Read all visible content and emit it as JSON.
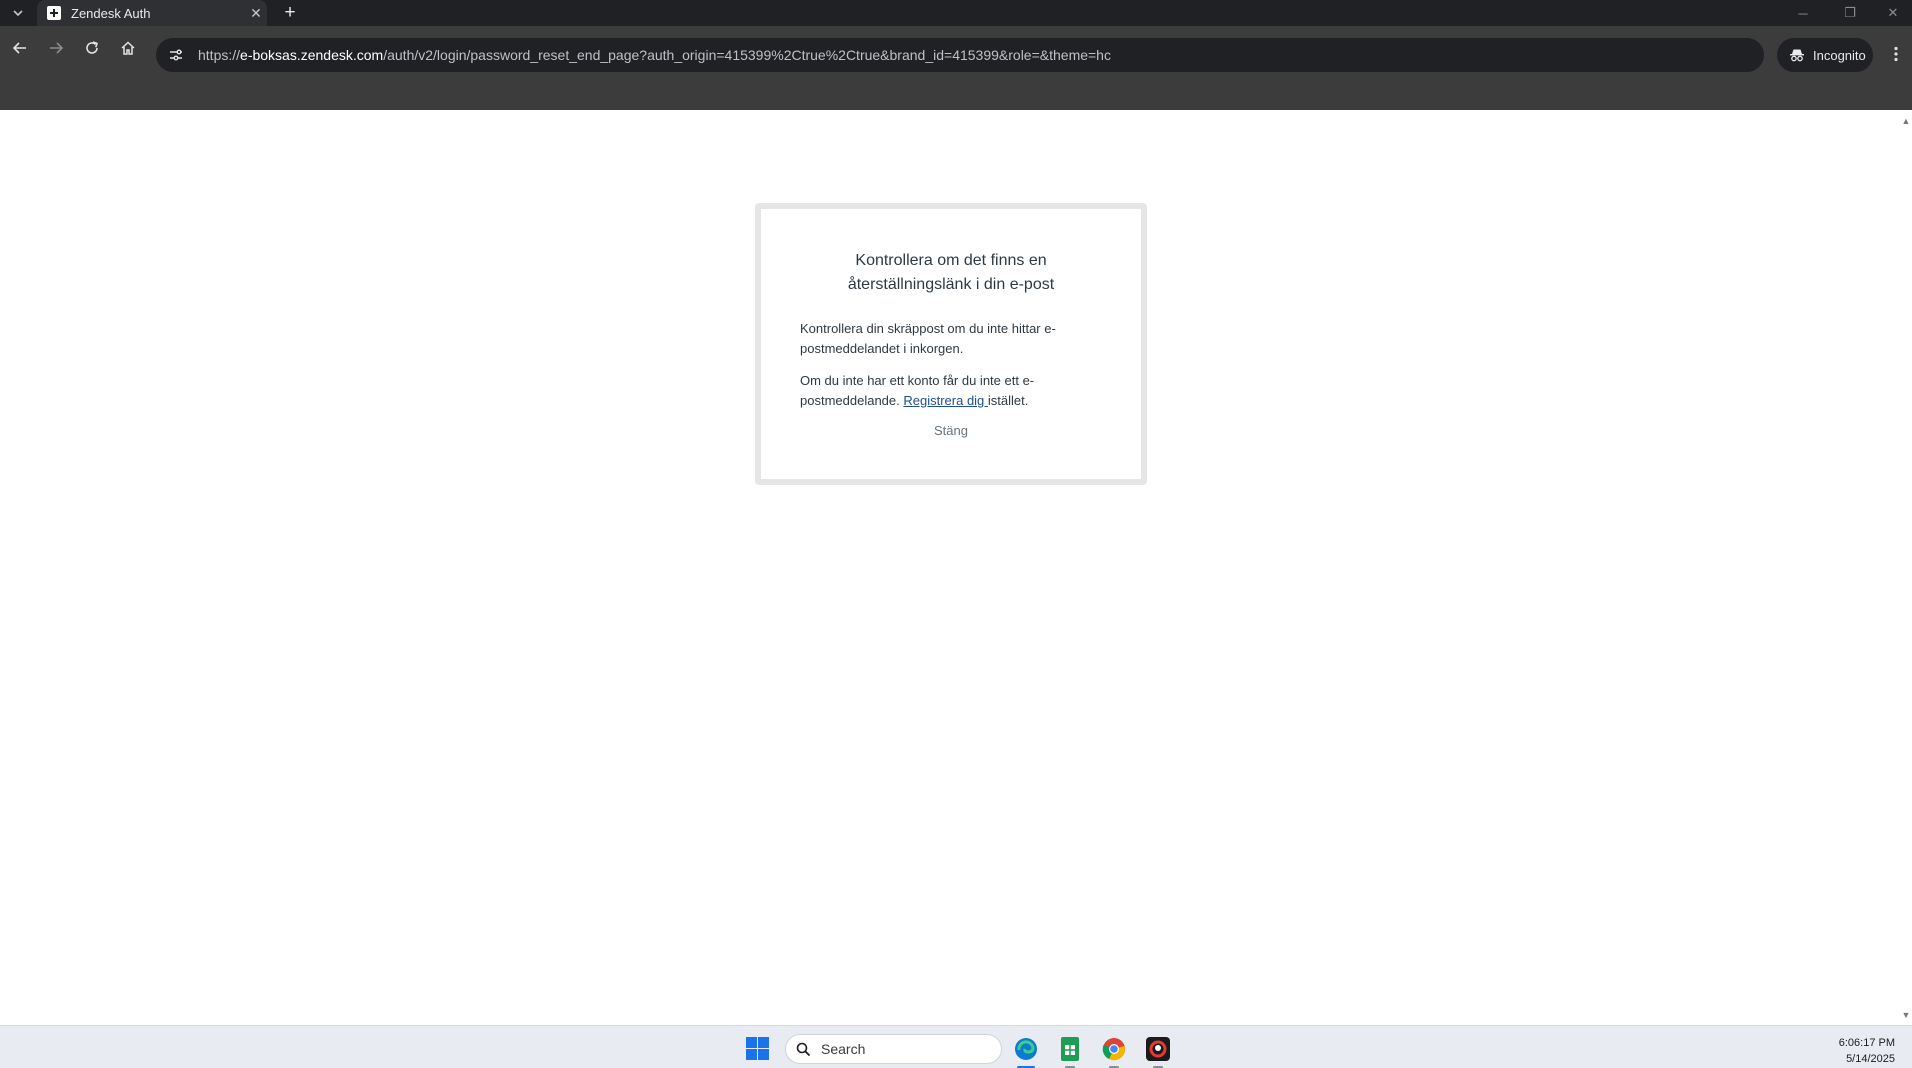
{
  "browser": {
    "tab_title": "Zendesk Auth",
    "url_prefix": "https://",
    "url_host": "e-boksas.zendesk.com",
    "url_path": "/auth/v2/login/password_reset_end_page?auth_origin=415399%2Ctrue%2Ctrue&brand_id=415399&role=&theme=hc",
    "incognito_label": "Incognito",
    "icons": [
      "tab-list-icon",
      "close-icon",
      "plus-icon",
      "back-icon",
      "forward-icon",
      "reload-icon",
      "home-icon",
      "site-settings-icon",
      "incognito-icon",
      "more-icon"
    ]
  },
  "dialog": {
    "title": "Kontrollera om det finns en återställningslänk i din e-post",
    "para1": "Kontrollera din skräppost om du inte hittar e-postmeddelandet i inkorgen.",
    "para2_before": "Om du inte har ett konto får du inte ett e-postmeddelande. ",
    "para2_link": "Registrera dig ",
    "para2_after": "istället.",
    "close_label": "Stäng",
    "accent_color": "#1f4f8c"
  },
  "taskbar": {
    "search_placeholder": "Search",
    "time": "6:06:17 PM",
    "date": "5/14/2025",
    "apps": [
      "edge",
      "spreadsheet",
      "chrome",
      "recorder"
    ]
  }
}
